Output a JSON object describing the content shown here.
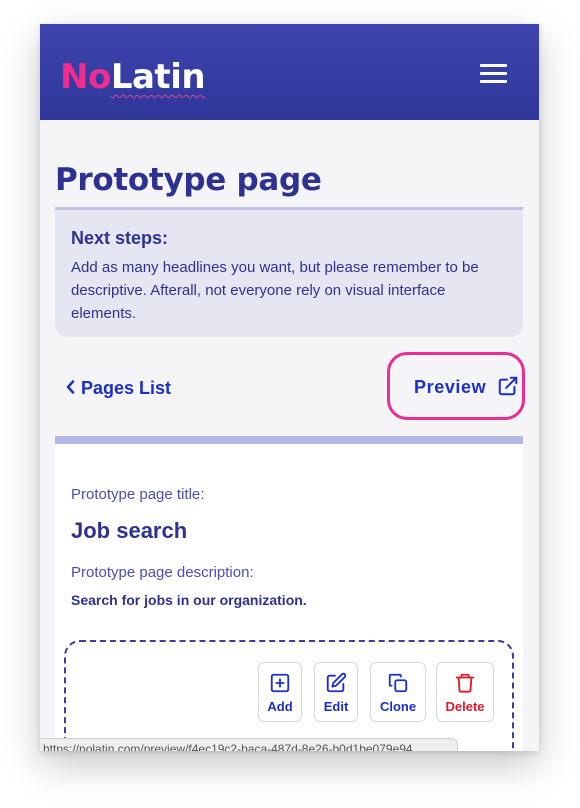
{
  "app": {
    "logo_part1": "No",
    "logo_part2": "Latin",
    "menu_icon": "hamburger-menu-icon"
  },
  "page": {
    "title": "Prototype page"
  },
  "next_steps": {
    "title": "Next steps:",
    "text": "Add as many headlines you want, but please remember to be descriptive. Afterall, not everyone rely on visual interface elements."
  },
  "nav": {
    "back_label": "Pages List",
    "back_icon": "chevron-left-icon",
    "preview_label": "Preview",
    "preview_icon": "external-link-icon"
  },
  "card": {
    "title_label": "Prototype page title:",
    "title_value": "Job search",
    "description_label": "Prototype page description:",
    "description_value": "Search for jobs in our organization."
  },
  "toolbar": {
    "add_label": "Add",
    "edit_label": "Edit",
    "clone_label": "Clone",
    "delete_label": "Delete"
  },
  "status_url": "https://nolatin.com/preview/f4ec19c2-baca-487d-8e26-b0d1be079e94",
  "colors": {
    "header_bg": "#3438a0",
    "brand_pink": "#ee2d90",
    "link_blue": "#1c30c8",
    "heading_navy": "#2d3192",
    "delete_red": "#e0192b"
  }
}
